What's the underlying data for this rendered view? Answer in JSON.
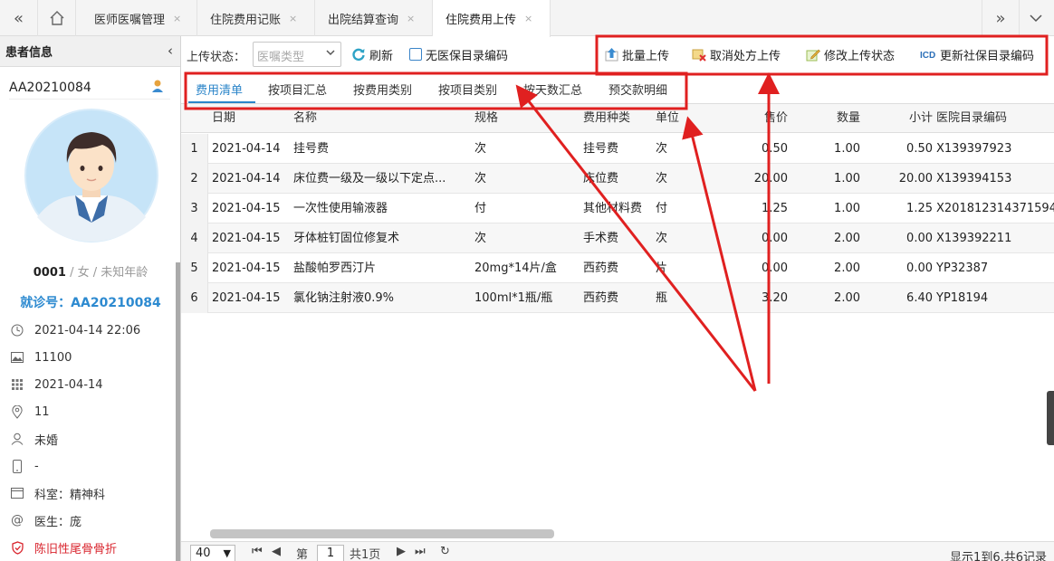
{
  "topbar": {
    "tabs": [
      {
        "label": "医师医嘱管理"
      },
      {
        "label": "住院费用记账"
      },
      {
        "label": "出院结算查询"
      },
      {
        "label": "住院费用上传"
      }
    ],
    "close_glyph": "×"
  },
  "patient": {
    "panel_title": "患者信息",
    "id": "AA20210084",
    "code": "0001",
    "gender_age": " / 女 / 未知年龄",
    "visit_no": "就诊号：AA20210084",
    "info": [
      {
        "icon": "clock-icon",
        "text": "2021-04-14 22:06"
      },
      {
        "icon": "image-icon",
        "text": "11100"
      },
      {
        "icon": "calendar-icon",
        "text": "2021-04-14"
      },
      {
        "icon": "location-icon",
        "text": "11"
      },
      {
        "icon": "person-icon",
        "text": "未婚"
      },
      {
        "icon": "phone-icon",
        "text": "-"
      },
      {
        "icon": "department-icon",
        "text": "科室：精神科"
      },
      {
        "icon": "at-icon",
        "text": "医生：庞"
      },
      {
        "icon": "shield-icon",
        "text": "陈旧性尾骨骨折"
      }
    ]
  },
  "toolbar": {
    "status_label": "上传状态：",
    "status_placeholder": "医嘱类型",
    "refresh": "刷新",
    "no_code": "无医保目录编码",
    "batch_upload": "批量上传",
    "cancel_upload": "取消处方上传",
    "modify_status": "修改上传状态",
    "update_code": "更新社保目录编码"
  },
  "subtabs": [
    "费用清单",
    "按项目汇总",
    "按费用类别",
    "按项目类别",
    "按天数汇总",
    "预交款明细"
  ],
  "grid": {
    "headers": [
      "日期",
      "名称",
      "规格",
      "费用种类",
      "单位",
      "售价",
      "数量",
      "小计",
      "医院目录编码"
    ],
    "rows": [
      {
        "n": "1",
        "date": "2021-04-14",
        "name": "挂号费",
        "spec": "次",
        "type": "挂号费",
        "unit": "次",
        "price": "0.50",
        "qty": "1.00",
        "total": "0.50",
        "code": "X139397923"
      },
      {
        "n": "2",
        "date": "2021-04-14",
        "name": "床位费一级及一级以下定点...",
        "spec": "次",
        "type": "床位费",
        "unit": "次",
        "price": "20.00",
        "qty": "1.00",
        "total": "20.00",
        "code": "X139394153"
      },
      {
        "n": "3",
        "date": "2021-04-15",
        "name": "一次性使用输液器",
        "spec": "付",
        "type": "其他材料费",
        "unit": "付",
        "price": "1.25",
        "qty": "1.00",
        "total": "1.25",
        "code": "X201812314371594"
      },
      {
        "n": "4",
        "date": "2021-04-15",
        "name": "牙体桩钉固位修复术",
        "spec": "次",
        "type": "手术费",
        "unit": "次",
        "price": "0.00",
        "qty": "2.00",
        "total": "0.00",
        "code": "X139392211"
      },
      {
        "n": "5",
        "date": "2021-04-15",
        "name": "盐酸帕罗西汀片",
        "spec": "20mg*14片/盒",
        "type": "西药费",
        "unit": "片",
        "price": "0.00",
        "qty": "2.00",
        "total": "0.00",
        "code": "YP32387"
      },
      {
        "n": "6",
        "date": "2021-04-15",
        "name": "氯化钠注射液0.9%",
        "spec": "100ml*1瓶/瓶",
        "type": "西药费",
        "unit": "瓶",
        "price": "3.20",
        "qty": "2.00",
        "total": "6.40",
        "code": "YP18194"
      }
    ]
  },
  "pager": {
    "page_size": "40",
    "page_prefix": "第",
    "page": "1",
    "page_suffix": "共1页",
    "summary": "显示1到6,共6记录"
  },
  "colors": {
    "accent": "#2b85c9",
    "annotation": "#e02020",
    "warning": "#d9252e"
  }
}
